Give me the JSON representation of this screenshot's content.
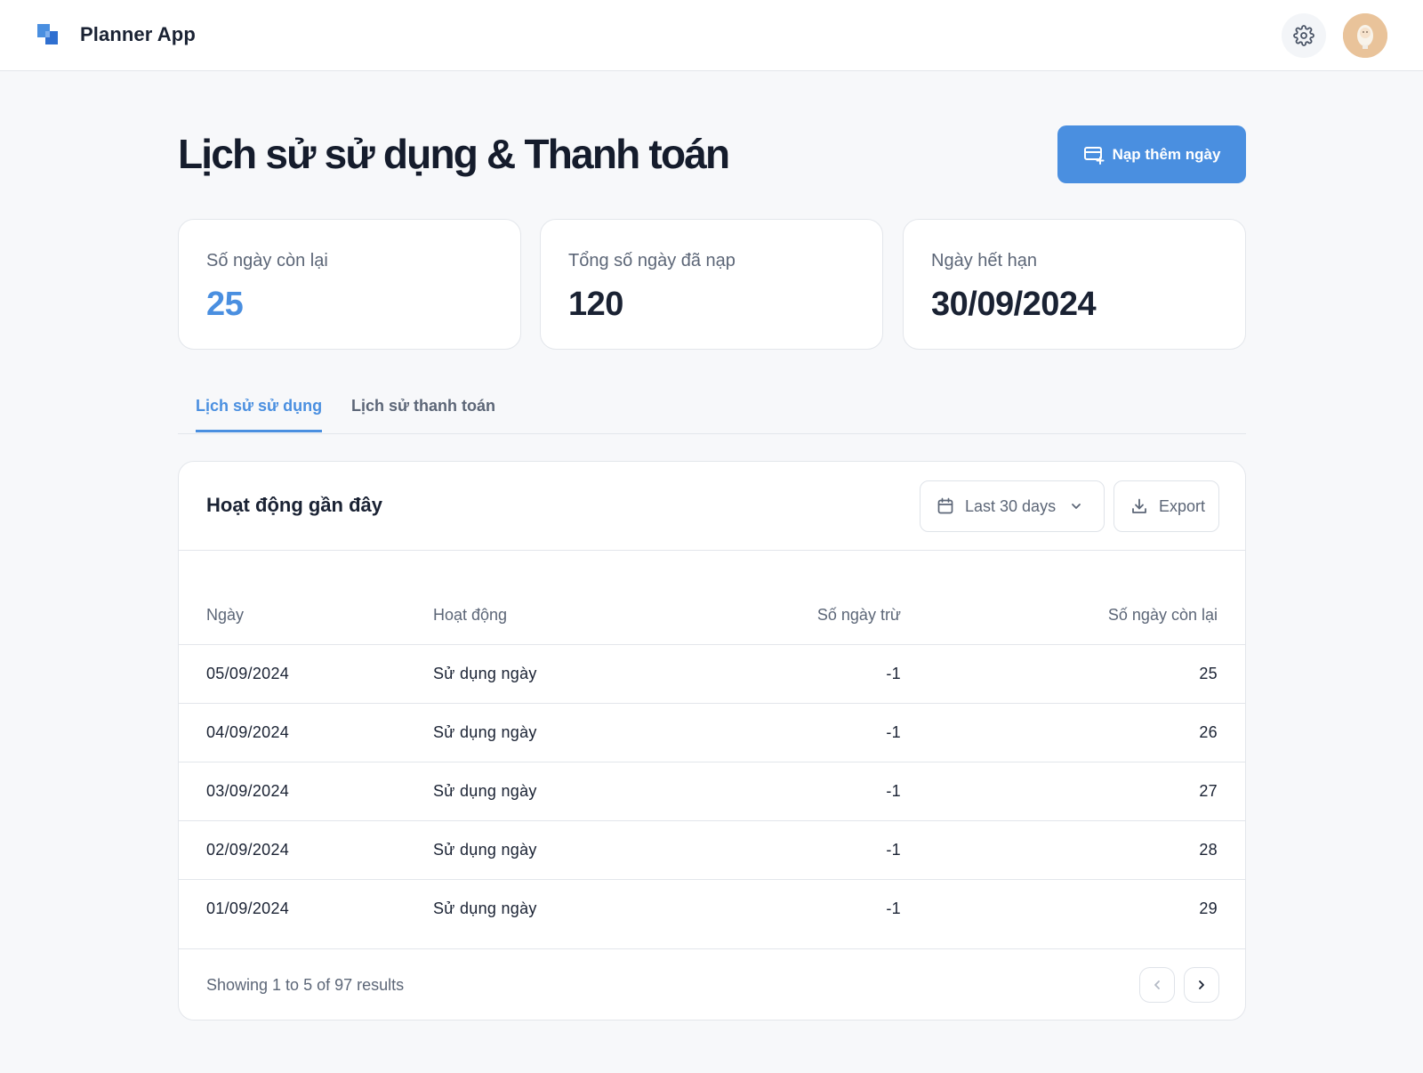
{
  "app": {
    "title": "Planner App",
    "brand_color": "#4a8fe0",
    "logo_icon": "stacked-squares-logo",
    "settings_icon": "gear-icon",
    "avatar_icon": "user-avatar"
  },
  "page": {
    "title": "Lịch sử sử dụng & Thanh toán",
    "topup_label": "Nạp thêm ngày",
    "topup_icon": "card-add-icon"
  },
  "stats": [
    {
      "label": "Số ngày còn lại",
      "value": "25"
    },
    {
      "label": "Tổng số ngày đã nạp",
      "value": "120"
    },
    {
      "label": "Ngày hết hạn",
      "value": "30/09/2024"
    }
  ],
  "tabs": [
    {
      "label": "Lịch sử sử dụng",
      "active": true
    },
    {
      "label": "Lịch sử thanh toán",
      "active": false
    }
  ],
  "activity": {
    "title": "Hoạt động gần đây",
    "range_label": "Last 30 days",
    "range_icon": "calendar-icon",
    "export_label": "Export",
    "export_icon": "download-icon",
    "columns": [
      "Ngày",
      "Hoạt động",
      "Số ngày trừ",
      "Số ngày còn lại"
    ],
    "rows": [
      {
        "date": "05/09/2024",
        "activity": "Sử dụng ngày",
        "deducted": "-1",
        "remaining": "25"
      },
      {
        "date": "04/09/2024",
        "activity": "Sử dụng ngày",
        "deducted": "-1",
        "remaining": "26"
      },
      {
        "date": "03/09/2024",
        "activity": "Sử dụng ngày",
        "deducted": "-1",
        "remaining": "27"
      },
      {
        "date": "02/09/2024",
        "activity": "Sử dụng ngày",
        "deducted": "-1",
        "remaining": "28"
      },
      {
        "date": "01/09/2024",
        "activity": "Sử dụng ngày",
        "deducted": "-1",
        "remaining": "29"
      }
    ],
    "results_text": "Showing 1 to 5 of 97 results"
  }
}
